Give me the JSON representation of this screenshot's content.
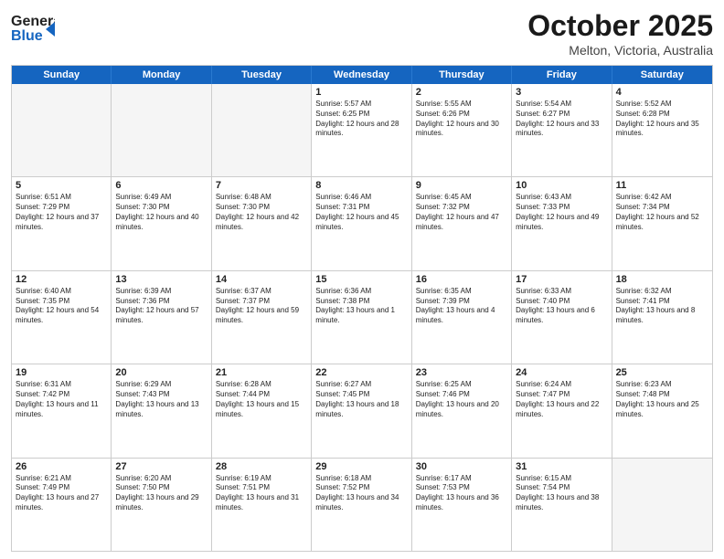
{
  "header": {
    "logo_line1": "General",
    "logo_line2": "Blue",
    "month": "October 2025",
    "location": "Melton, Victoria, Australia"
  },
  "days": [
    "Sunday",
    "Monday",
    "Tuesday",
    "Wednesday",
    "Thursday",
    "Friday",
    "Saturday"
  ],
  "rows": [
    [
      {
        "day": "",
        "empty": true
      },
      {
        "day": "",
        "empty": true
      },
      {
        "day": "",
        "empty": true
      },
      {
        "day": "1",
        "rise": "5:57 AM",
        "set": "6:25 PM",
        "daylight": "12 hours and 28 minutes."
      },
      {
        "day": "2",
        "rise": "5:55 AM",
        "set": "6:26 PM",
        "daylight": "12 hours and 30 minutes."
      },
      {
        "day": "3",
        "rise": "5:54 AM",
        "set": "6:27 PM",
        "daylight": "12 hours and 33 minutes."
      },
      {
        "day": "4",
        "rise": "5:52 AM",
        "set": "6:28 PM",
        "daylight": "12 hours and 35 minutes."
      }
    ],
    [
      {
        "day": "5",
        "rise": "6:51 AM",
        "set": "7:29 PM",
        "daylight": "12 hours and 37 minutes."
      },
      {
        "day": "6",
        "rise": "6:49 AM",
        "set": "7:30 PM",
        "daylight": "12 hours and 40 minutes."
      },
      {
        "day": "7",
        "rise": "6:48 AM",
        "set": "7:30 PM",
        "daylight": "12 hours and 42 minutes."
      },
      {
        "day": "8",
        "rise": "6:46 AM",
        "set": "7:31 PM",
        "daylight": "12 hours and 45 minutes."
      },
      {
        "day": "9",
        "rise": "6:45 AM",
        "set": "7:32 PM",
        "daylight": "12 hours and 47 minutes."
      },
      {
        "day": "10",
        "rise": "6:43 AM",
        "set": "7:33 PM",
        "daylight": "12 hours and 49 minutes."
      },
      {
        "day": "11",
        "rise": "6:42 AM",
        "set": "7:34 PM",
        "daylight": "12 hours and 52 minutes."
      }
    ],
    [
      {
        "day": "12",
        "rise": "6:40 AM",
        "set": "7:35 PM",
        "daylight": "12 hours and 54 minutes."
      },
      {
        "day": "13",
        "rise": "6:39 AM",
        "set": "7:36 PM",
        "daylight": "12 hours and 57 minutes."
      },
      {
        "day": "14",
        "rise": "6:37 AM",
        "set": "7:37 PM",
        "daylight": "12 hours and 59 minutes."
      },
      {
        "day": "15",
        "rise": "6:36 AM",
        "set": "7:38 PM",
        "daylight": "13 hours and 1 minute."
      },
      {
        "day": "16",
        "rise": "6:35 AM",
        "set": "7:39 PM",
        "daylight": "13 hours and 4 minutes."
      },
      {
        "day": "17",
        "rise": "6:33 AM",
        "set": "7:40 PM",
        "daylight": "13 hours and 6 minutes."
      },
      {
        "day": "18",
        "rise": "6:32 AM",
        "set": "7:41 PM",
        "daylight": "13 hours and 8 minutes."
      }
    ],
    [
      {
        "day": "19",
        "rise": "6:31 AM",
        "set": "7:42 PM",
        "daylight": "13 hours and 11 minutes."
      },
      {
        "day": "20",
        "rise": "6:29 AM",
        "set": "7:43 PM",
        "daylight": "13 hours and 13 minutes."
      },
      {
        "day": "21",
        "rise": "6:28 AM",
        "set": "7:44 PM",
        "daylight": "13 hours and 15 minutes."
      },
      {
        "day": "22",
        "rise": "6:27 AM",
        "set": "7:45 PM",
        "daylight": "13 hours and 18 minutes."
      },
      {
        "day": "23",
        "rise": "6:25 AM",
        "set": "7:46 PM",
        "daylight": "13 hours and 20 minutes."
      },
      {
        "day": "24",
        "rise": "6:24 AM",
        "set": "7:47 PM",
        "daylight": "13 hours and 22 minutes."
      },
      {
        "day": "25",
        "rise": "6:23 AM",
        "set": "7:48 PM",
        "daylight": "13 hours and 25 minutes."
      }
    ],
    [
      {
        "day": "26",
        "rise": "6:21 AM",
        "set": "7:49 PM",
        "daylight": "13 hours and 27 minutes."
      },
      {
        "day": "27",
        "rise": "6:20 AM",
        "set": "7:50 PM",
        "daylight": "13 hours and 29 minutes."
      },
      {
        "day": "28",
        "rise": "6:19 AM",
        "set": "7:51 PM",
        "daylight": "13 hours and 31 minutes."
      },
      {
        "day": "29",
        "rise": "6:18 AM",
        "set": "7:52 PM",
        "daylight": "13 hours and 34 minutes."
      },
      {
        "day": "30",
        "rise": "6:17 AM",
        "set": "7:53 PM",
        "daylight": "13 hours and 36 minutes."
      },
      {
        "day": "31",
        "rise": "6:15 AM",
        "set": "7:54 PM",
        "daylight": "13 hours and 38 minutes."
      },
      {
        "day": "",
        "empty": true
      }
    ]
  ]
}
